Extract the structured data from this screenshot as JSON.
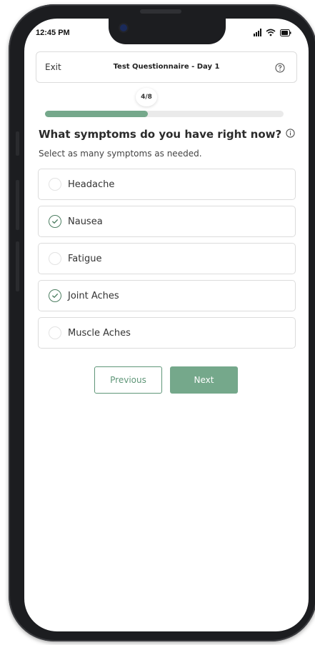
{
  "status_bar": {
    "time": "12:45 PM"
  },
  "header": {
    "exit_label": "Exit",
    "title": "Test Questionnaire - Day 1"
  },
  "progress": {
    "label": "4/8",
    "fraction": 0.43
  },
  "question": {
    "title": "What symptoms do you have right now?",
    "subtitle": "Select as many symptoms as needed."
  },
  "options": [
    {
      "label": "Headache",
      "checked": false
    },
    {
      "label": "Nausea",
      "checked": true
    },
    {
      "label": "Fatigue",
      "checked": false
    },
    {
      "label": "Joint Aches",
      "checked": true
    },
    {
      "label": "Muscle Aches",
      "checked": false
    }
  ],
  "buttons": {
    "previous": "Previous",
    "next": "Next"
  },
  "colors": {
    "accent": "#75a88b",
    "accent_dark": "#4d7e62",
    "phone_frame": "#1c1d20"
  },
  "icons": {
    "help": "help-circle-icon",
    "info": "info-icon",
    "check": "check-circle-icon",
    "signal": "signal-icon",
    "wifi": "wifi-icon",
    "battery": "battery-icon"
  }
}
